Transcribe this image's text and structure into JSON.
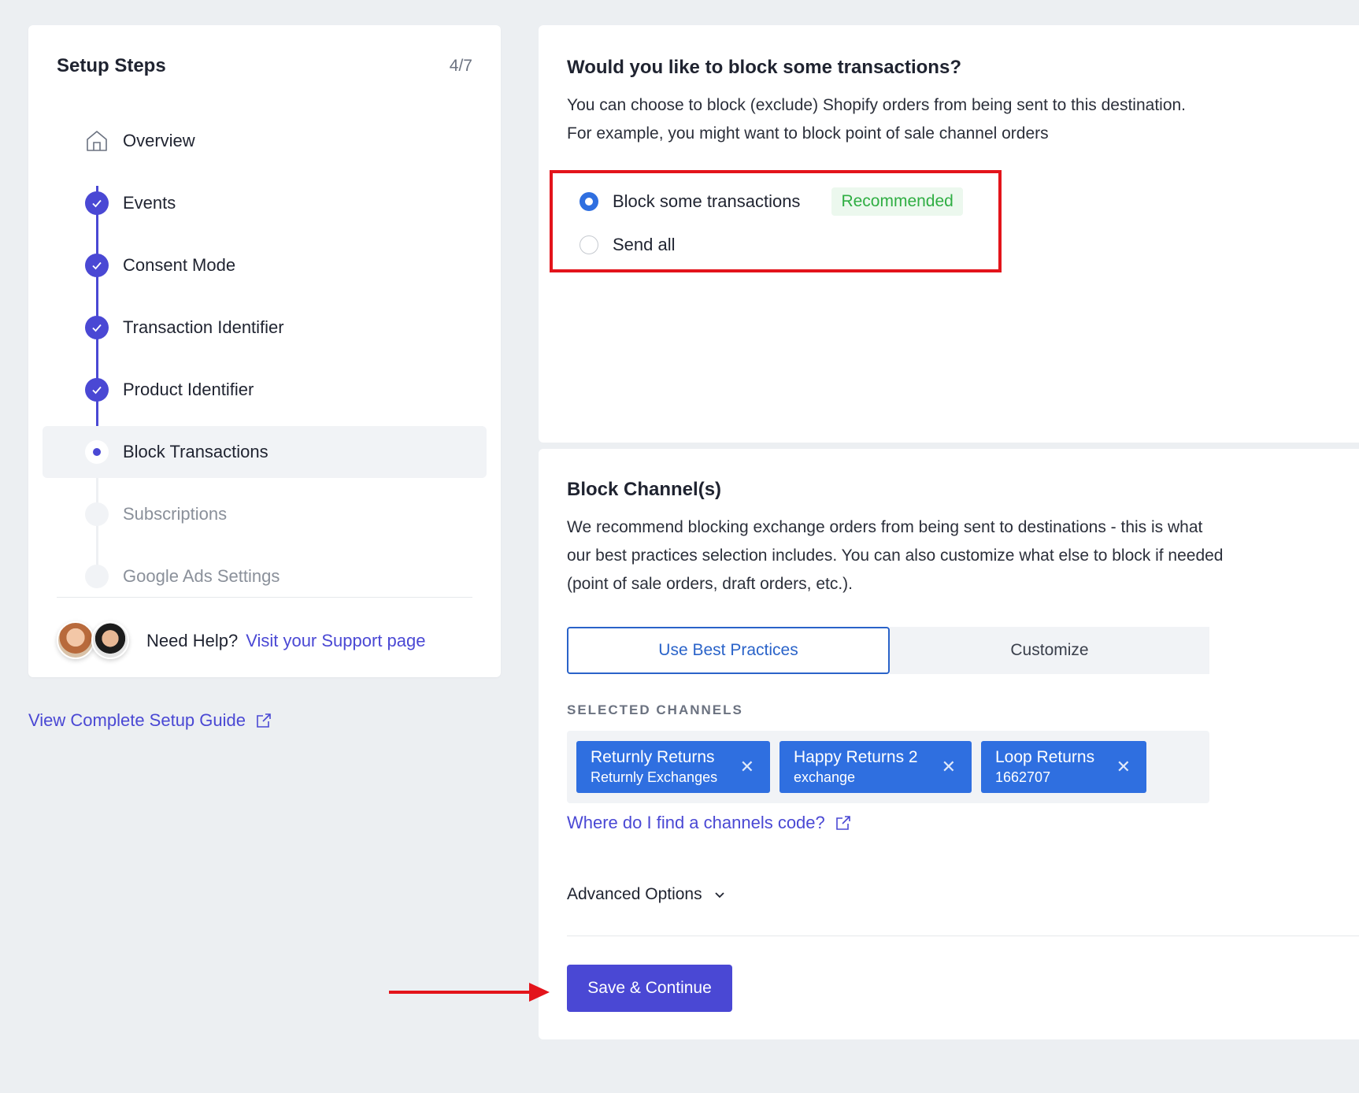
{
  "sidebar": {
    "title": "Setup Steps",
    "count": "4/7",
    "steps": [
      {
        "label": "Overview"
      },
      {
        "label": "Events"
      },
      {
        "label": "Consent Mode"
      },
      {
        "label": "Transaction Identifier"
      },
      {
        "label": "Product Identifier"
      },
      {
        "label": "Block Transactions"
      },
      {
        "label": "Subscriptions"
      },
      {
        "label": "Google Ads Settings"
      }
    ],
    "help_text": "Need Help?",
    "help_link": "Visit your Support page",
    "guide_link": "View Complete Setup Guide"
  },
  "block_question": {
    "title": "Would you like to block some transactions?",
    "description": "You can choose to block (exclude) Shopify orders from being sent to this destination. For example, you might want to block point of sale channel orders",
    "options": [
      {
        "label": "Block some transactions",
        "badge": "Recommended"
      },
      {
        "label": "Send all"
      }
    ]
  },
  "block_channels": {
    "title": "Block Channel(s)",
    "description": "We recommend blocking exchange orders from being sent to destinations - this is what our best practices selection includes. You can also customize what else to block if needed (point of sale orders, draft orders, etc.).",
    "tabs": [
      "Use Best Practices",
      "Customize"
    ],
    "selected_label": "SELECTED CHANNELS",
    "chips": [
      {
        "name": "Returnly Returns",
        "code": "Returnly Exchanges"
      },
      {
        "name": "Happy Returns 2",
        "code": "exchange"
      },
      {
        "name": "Loop Returns",
        "code": "1662707"
      }
    ],
    "find_link": "Where do I find a channels code?",
    "advanced": "Advanced Options",
    "save": "Save & Continue"
  },
  "colors": {
    "accent": "#4a48d4",
    "chip": "#2f6fe0",
    "highlight": "#e3141b",
    "recommended": "#2fae43"
  }
}
